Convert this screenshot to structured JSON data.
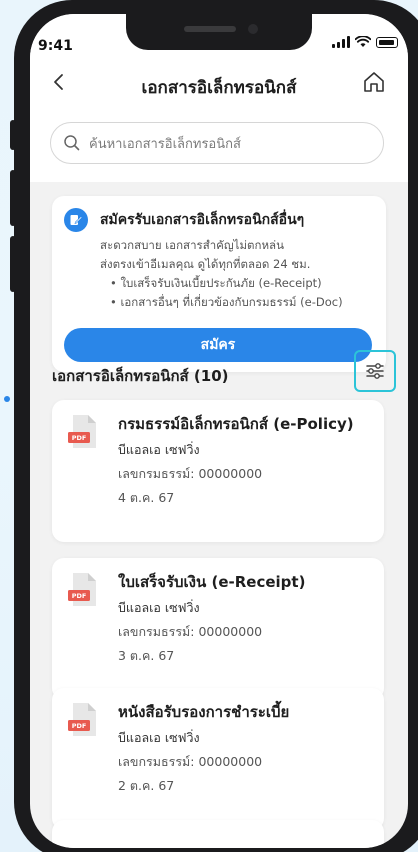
{
  "status": {
    "time": "9:41"
  },
  "header": {
    "title": "เอกสารอิเล็กทรอนิกส์",
    "back_icon": "chevron-left-icon",
    "home_icon": "home-icon"
  },
  "search": {
    "placeholder": "ค้นหาเอกสารอิเล็กทรอนิกส์"
  },
  "promo": {
    "title": "สมัครรับเอกสารอิเล็กทรอนิกส์อื่นๆ",
    "line1": "สะดวกสบาย เอกสารสำคัญไม่ตกหล่น",
    "line2": "ส่งตรงเข้าอีเมลคุณ ดูได้ทุกที่ตลอด 24 ชม.",
    "bullet1": "• ใบเสร็จรับเงินเบี้ยประกันภัย (e-Receipt)",
    "bullet2": "• เอกสารอื่นๆ ที่เกี่ยวข้องกับกรมธรรม์ (e-Doc)",
    "button": "สมัคร"
  },
  "section": {
    "title": "เอกสารอิเล็กทรอนิกส์ (10)"
  },
  "documents": [
    {
      "title": "กรมธรรม์อิเล็กทรอนิกส์ (e-Policy)",
      "insurer": "บีแอลเอ เซฟวิ่ง",
      "policy": "เลขกรมธรรม์: 00000000",
      "date": "4 ต.ค. 67"
    },
    {
      "title": "ใบเสร็จรับเงิน (e-Receipt)",
      "insurer": "บีแอลเอ เซฟวิ่ง",
      "policy": "เลขกรมธรรม์: 00000000",
      "date": "3 ต.ค. 67"
    },
    {
      "title": "หนังสือรับรองการชำระเบี้ย",
      "insurer": "บีแอลเอ เซฟวิ่ง",
      "policy": "เลขกรมธรรม์: 00000000",
      "date": "2 ต.ค. 67"
    }
  ],
  "pdf_label": "PDF",
  "colors": {
    "primary": "#2a86e8",
    "highlight": "#2cc4d8",
    "pdf": "#e85a4f"
  }
}
